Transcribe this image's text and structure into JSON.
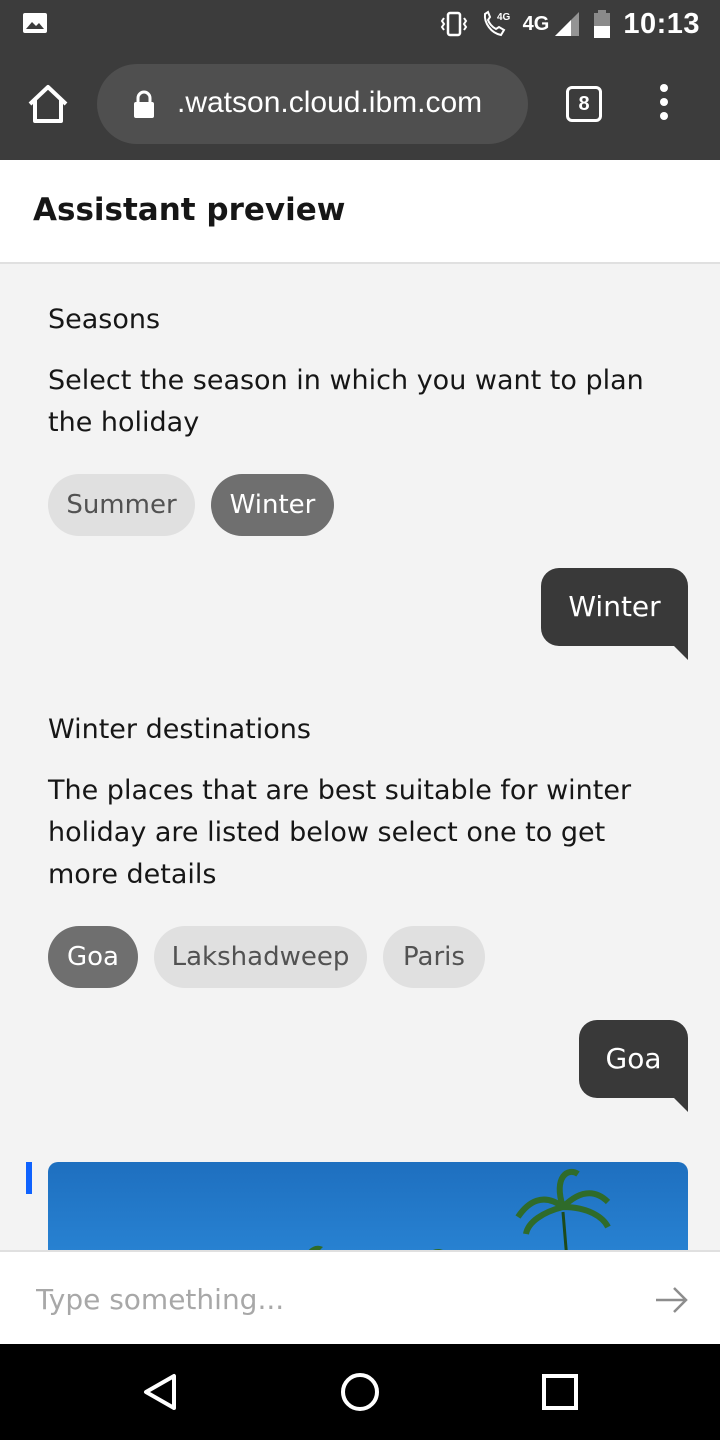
{
  "status_bar": {
    "network": "4G",
    "volte": "4G",
    "time": "10:13"
  },
  "browser": {
    "url": ".watson.cloud.ibm.com",
    "tab_count": "8"
  },
  "header": {
    "title": "Assistant preview"
  },
  "conversation": {
    "seasons": {
      "title": "Seasons",
      "text": "Select the season in which you want to plan the holiday",
      "options": [
        {
          "label": "Summer",
          "selected": false
        },
        {
          "label": "Winter",
          "selected": true
        }
      ]
    },
    "user_reply_1": "Winter",
    "winter": {
      "title": "Winter destinations",
      "text": "The places that are best suitable for winter holiday are listed below select one to get more details",
      "options": [
        {
          "label": "Goa",
          "selected": true
        },
        {
          "label": "Lakshadweep",
          "selected": false
        },
        {
          "label": "Paris",
          "selected": false
        }
      ]
    },
    "user_reply_2": "Goa"
  },
  "input": {
    "placeholder": "Type something..."
  },
  "colors": {
    "browser_chrome": "#3c3c3c",
    "chat_background": "#f3f3f3",
    "user_bubble": "#393939",
    "chip_selected": "#6f6f6f",
    "chip_unselected": "#e0e0e0",
    "accent_marker": "#0f62fe"
  },
  "icons": {
    "status_left": "image-icon",
    "status_right": [
      "vibrate-icon",
      "volte-call-icon",
      "signal-icon",
      "battery-icon"
    ],
    "browser": [
      "home-icon",
      "lock-icon",
      "tabs-icon",
      "more-vert-icon"
    ],
    "send": "arrow-right-icon",
    "nav": [
      "back-icon",
      "home-circle-icon",
      "recents-icon"
    ]
  }
}
